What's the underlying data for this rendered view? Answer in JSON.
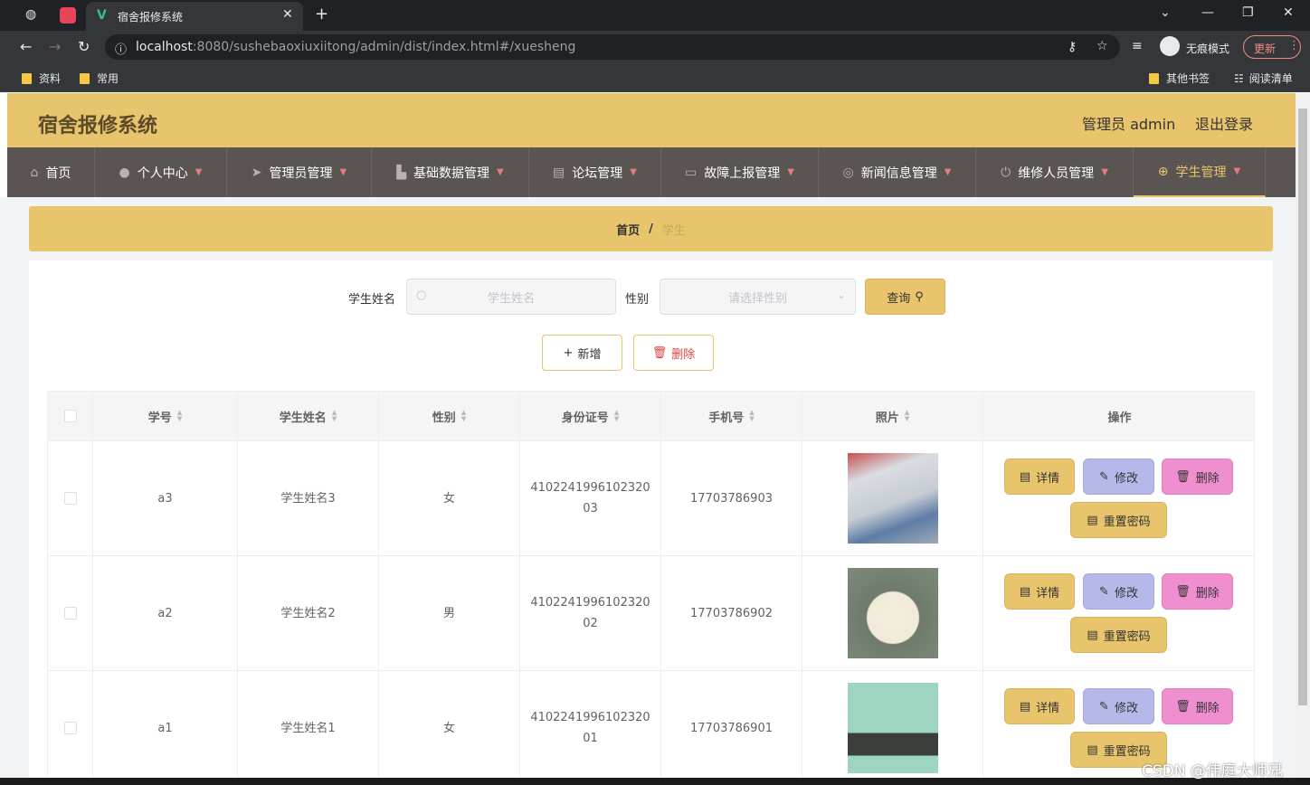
{
  "browser": {
    "tab_title": "宿舍报修系统",
    "url_host": "localhost",
    "url_rest": ":8080/sushebaoxiuxiitong/admin/dist/index.html#/xuesheng",
    "incognito_label": "无痕模式",
    "update_label": "更新",
    "bookmarks": [
      "资料",
      "常用"
    ],
    "other_bookmarks": "其他书签",
    "reading_list": "阅读清单"
  },
  "app": {
    "title": "宿舍报修系统",
    "user_label": "管理员 admin",
    "logout_label": "退出登录"
  },
  "nav": [
    {
      "label": "首页",
      "icon": "home-icon"
    },
    {
      "label": "个人中心",
      "icon": "user-icon"
    },
    {
      "label": "管理员管理",
      "icon": "paper-plane-icon"
    },
    {
      "label": "基础数据管理",
      "icon": "brush-icon"
    },
    {
      "label": "论坛管理",
      "icon": "clipboard-icon"
    },
    {
      "label": "故障上报管理",
      "icon": "monitor-icon"
    },
    {
      "label": "新闻信息管理",
      "icon": "target-icon"
    },
    {
      "label": "维修人员管理",
      "icon": "power-icon"
    },
    {
      "label": "学生管理",
      "icon": "crosshair-icon"
    }
  ],
  "breadcrumb": {
    "home": "首页",
    "separator": "/",
    "current": "学生"
  },
  "search": {
    "name_label": "学生姓名",
    "name_placeholder": "学生姓名",
    "gender_label": "性别",
    "gender_placeholder": "请选择性别",
    "query_label": "查询"
  },
  "actions": {
    "add_label": "新增",
    "delete_label": "删除"
  },
  "table": {
    "headers": [
      "学号",
      "学生姓名",
      "性别",
      "身份证号",
      "手机号",
      "照片",
      "操作"
    ],
    "rows": [
      {
        "id": "a3",
        "name": "学生姓名3",
        "gender": "女",
        "idcard_1": "4102241996102320",
        "idcard_2": "03",
        "phone": "17703786903"
      },
      {
        "id": "a2",
        "name": "学生姓名2",
        "gender": "男",
        "idcard_1": "4102241996102320",
        "idcard_2": "02",
        "phone": "17703786902"
      },
      {
        "id": "a1",
        "name": "学生姓名1",
        "gender": "女",
        "idcard_1": "4102241996102320",
        "idcard_2": "01",
        "phone": "17703786901"
      }
    ],
    "op_labels": {
      "detail": "详情",
      "edit": "修改",
      "delete": "删除",
      "reset": "重置密码"
    }
  },
  "watermark": "CSDN @伟庭大师兄",
  "colors": {
    "accent": "#e8c46c",
    "nav_bg": "#5a5452",
    "edit": "#b4b9ea",
    "delete": "#f08fd0"
  }
}
